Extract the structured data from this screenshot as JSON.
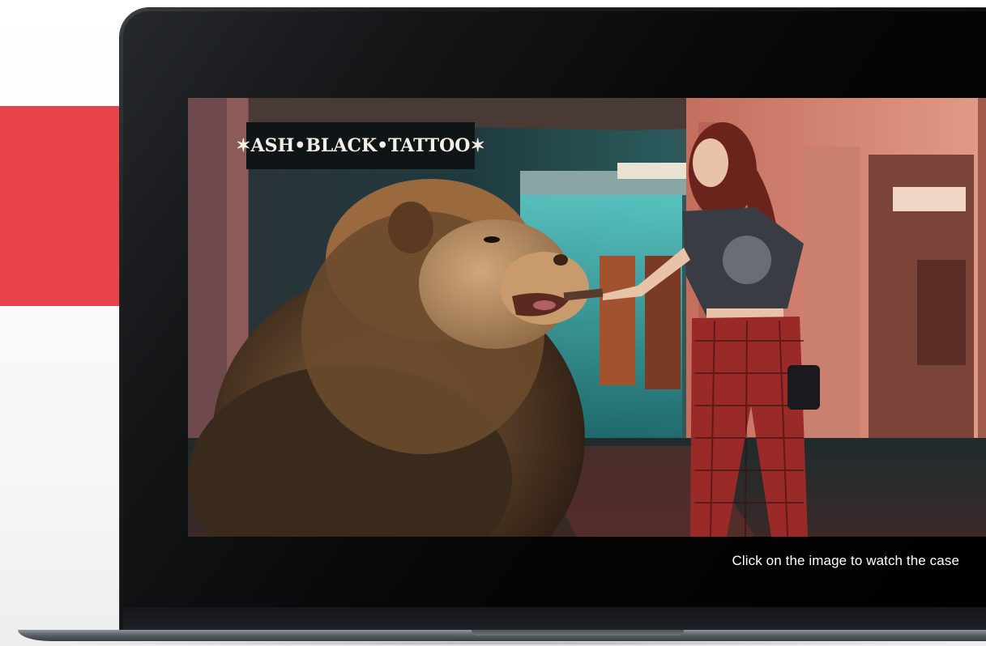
{
  "video": {
    "sign_text": "✶ASH•BLACK•TATTOO✶",
    "caption": "Click on the image to watch the case"
  },
  "colors": {
    "accent_red": "#e8434a",
    "laptop_frame": "#0a0a0b",
    "screen_black": "#000000"
  },
  "icons": {
    "laptop": "laptop-mockup"
  }
}
